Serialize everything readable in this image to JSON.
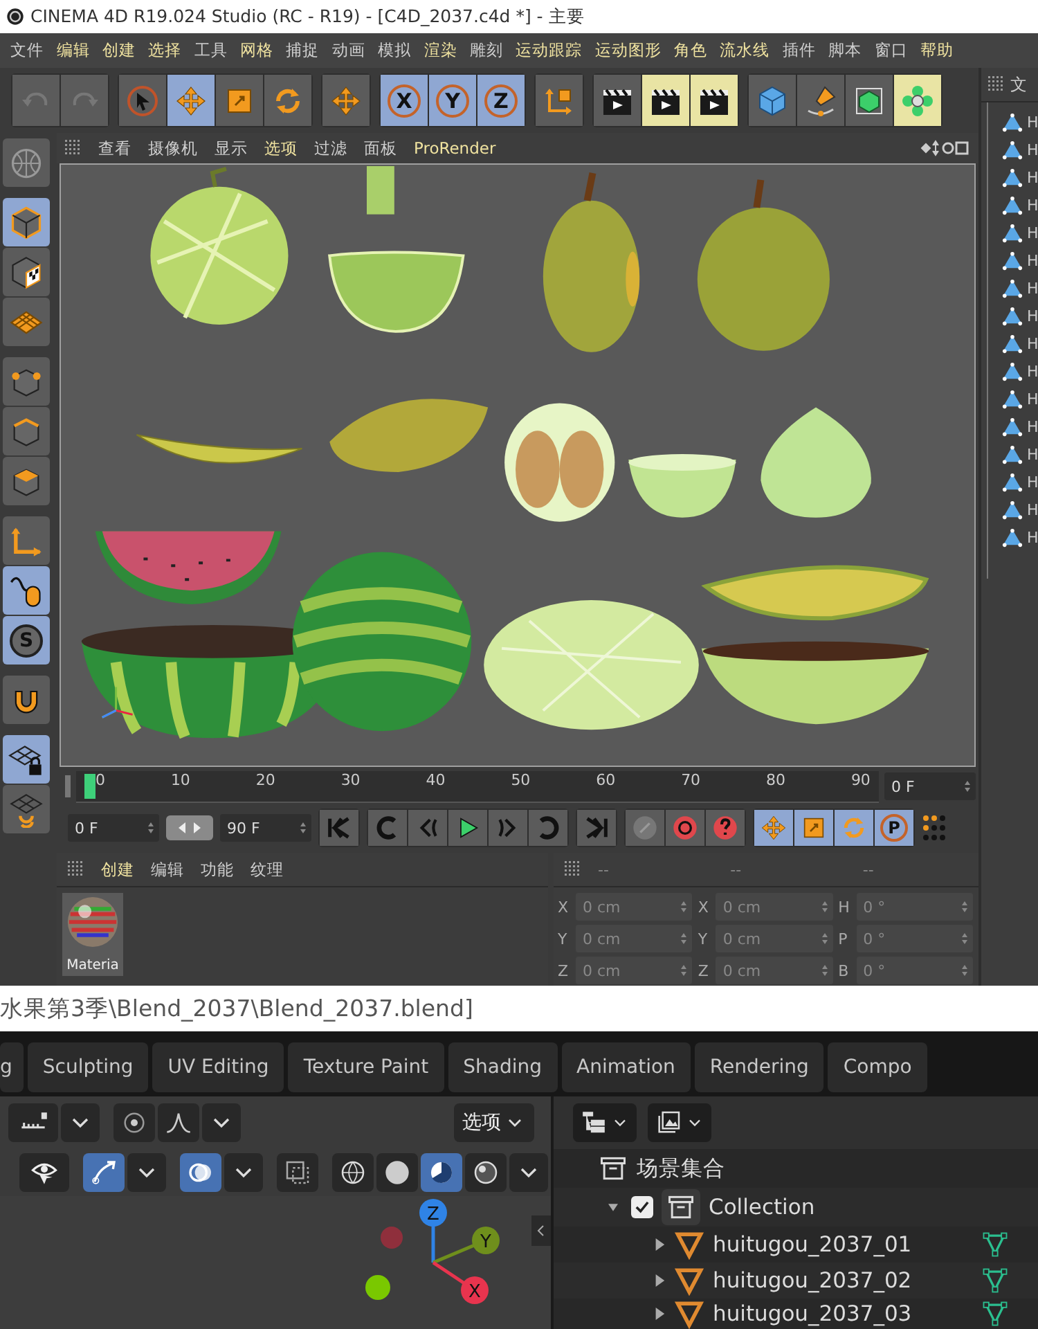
{
  "c4d": {
    "title": "CINEMA 4D R19.024 Studio (RC - R19) - [C4D_2037.c4d *] - 主要",
    "menu": [
      {
        "label": "文件",
        "accent": false
      },
      {
        "label": "编辑",
        "accent": true
      },
      {
        "label": "创建",
        "accent": true
      },
      {
        "label": "选择",
        "accent": true
      },
      {
        "label": "工具",
        "accent": false
      },
      {
        "label": "网格",
        "accent": true
      },
      {
        "label": "捕捉",
        "accent": false
      },
      {
        "label": "动画",
        "accent": false
      },
      {
        "label": "模拟",
        "accent": false
      },
      {
        "label": "渲染",
        "accent": true
      },
      {
        "label": "雕刻",
        "accent": false
      },
      {
        "label": "运动跟踪",
        "accent": true
      },
      {
        "label": "运动图形",
        "accent": true
      },
      {
        "label": "角色",
        "accent": true
      },
      {
        "label": "流水线",
        "accent": true
      },
      {
        "label": "插件",
        "accent": false
      },
      {
        "label": "脚本",
        "accent": false
      },
      {
        "label": "窗口",
        "accent": false
      },
      {
        "label": "帮助",
        "accent": true
      }
    ],
    "toolbar": [
      {
        "selected": false,
        "active": false
      },
      {
        "selected": false,
        "active": false
      },
      {
        "selected": false,
        "active": false
      },
      {
        "selected": true,
        "active": false
      },
      {
        "selected": false,
        "active": false
      },
      {
        "selected": false,
        "active": false
      },
      {
        "selected": false,
        "active": false
      },
      {
        "label": "X",
        "selected": true,
        "active": false
      },
      {
        "label": "Y",
        "selected": true,
        "active": false
      },
      {
        "label": "Z",
        "selected": true,
        "active": false
      },
      {
        "selected": false,
        "active": false
      },
      {
        "selected": false,
        "active": false
      },
      {
        "selected": false,
        "active": true
      },
      {
        "selected": false,
        "active": true
      },
      {
        "selected": false,
        "active": false
      },
      {
        "selected": false,
        "active": false
      },
      {
        "selected": false,
        "active": false
      },
      {
        "selected": false,
        "active": true
      }
    ],
    "tools": [
      {
        "selected": false
      },
      {
        "selected": true
      },
      {
        "selected": false
      },
      {
        "selected": false
      },
      {
        "selected": false
      },
      {
        "selected": false
      },
      {
        "selected": false
      },
      {
        "selected": false
      },
      {
        "selected": true
      },
      {
        "label": "S",
        "selected": true
      },
      {
        "selected": false
      },
      {
        "selected": true
      },
      {
        "selected": false
      }
    ],
    "viewport_menu": [
      {
        "label": "查看",
        "accent": false
      },
      {
        "label": "摄像机",
        "accent": false
      },
      {
        "label": "显示",
        "accent": false
      },
      {
        "label": "选项",
        "accent": true
      },
      {
        "label": "过滤",
        "accent": false
      },
      {
        "label": "面板",
        "accent": false
      },
      {
        "label": "ProRender",
        "accent": true
      }
    ],
    "timeline": {
      "ticks": [
        "0",
        "10",
        "20",
        "30",
        "40",
        "50",
        "60",
        "70",
        "80",
        "90"
      ],
      "frame": "0 F"
    },
    "transport": {
      "start": "0 F",
      "end": "90 F",
      "pla_label": "P"
    },
    "materials": {
      "tabs": [
        {
          "label": "创建",
          "accent": true
        },
        {
          "label": "编辑",
          "accent": false
        },
        {
          "label": "功能",
          "accent": false
        },
        {
          "label": "纹理",
          "accent": false
        }
      ],
      "items": [
        {
          "name": "Materia"
        }
      ]
    },
    "coordinates": {
      "headers": [
        "--",
        "--",
        "--"
      ],
      "rows": [
        [
          {
            "axis": "X",
            "value": "0 cm"
          },
          {
            "axis": "X",
            "value": "0 cm"
          },
          {
            "axis": "H",
            "value": "0 °"
          }
        ],
        [
          {
            "axis": "Y",
            "value": "0 cm"
          },
          {
            "axis": "Y",
            "value": "0 cm"
          },
          {
            "axis": "P",
            "value": "0 °"
          }
        ],
        [
          {
            "axis": "Z",
            "value": "0 cm"
          },
          {
            "axis": "Z",
            "value": "0 cm"
          },
          {
            "axis": "B",
            "value": "0 °"
          }
        ]
      ]
    },
    "objects": {
      "header": "文",
      "rows": [
        {
          "name": "H"
        },
        {
          "name": "H"
        },
        {
          "name": "H"
        },
        {
          "name": "H"
        },
        {
          "name": "H"
        },
        {
          "name": "H"
        },
        {
          "name": "H"
        },
        {
          "name": "H"
        },
        {
          "name": "H"
        },
        {
          "name": "H"
        },
        {
          "name": "H"
        },
        {
          "name": "H"
        },
        {
          "name": "H"
        },
        {
          "name": "H"
        },
        {
          "name": "H"
        },
        {
          "name": "H"
        }
      ]
    }
  },
  "blender": {
    "title": "水果第3季\\Blend_2037\\Blend_2037.blend]",
    "workspaces": [
      {
        "label": "g",
        "selected": false
      },
      {
        "label": "Sculpting",
        "selected": false
      },
      {
        "label": "UV Editing",
        "selected": false
      },
      {
        "label": "Texture Paint",
        "selected": false
      },
      {
        "label": "Shading",
        "selected": false
      },
      {
        "label": "Animation",
        "selected": false
      },
      {
        "label": "Rendering",
        "selected": false
      },
      {
        "label": "Compo",
        "selected": false
      }
    ],
    "options": "选项",
    "gizmo": [
      {
        "axis": "Z",
        "color": "#2f83e6"
      },
      {
        "axis": "Y",
        "color": "#6f8f1c"
      },
      {
        "axis": "X",
        "color": "#e8344e"
      }
    ],
    "outliner": {
      "root": "场景集合",
      "collection": {
        "name": "Collection",
        "checked": true,
        "expanded": true,
        "children": [
          {
            "name": "huitugou_2037_01"
          },
          {
            "name": "huitugou_2037_02"
          },
          {
            "name": "huitugou_2037_03"
          }
        ]
      }
    }
  }
}
